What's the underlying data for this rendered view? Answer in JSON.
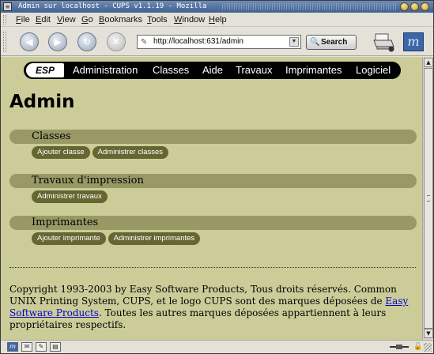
{
  "window": {
    "title": "Admin sur localhost - CUPS v1.1.19 - Mozilla",
    "system_menu_glyph": "≡"
  },
  "menubar": {
    "items": [
      {
        "mnemonic": "F",
        "rest": "ile"
      },
      {
        "mnemonic": "E",
        "rest": "dit"
      },
      {
        "mnemonic": "V",
        "rest": "iew"
      },
      {
        "mnemonic": "G",
        "rest": "o"
      },
      {
        "mnemonic": "B",
        "rest": "ookmarks"
      },
      {
        "mnemonic": "T",
        "rest": "ools"
      },
      {
        "mnemonic": "W",
        "rest": "indow"
      },
      {
        "mnemonic": "H",
        "rest": "elp"
      }
    ]
  },
  "toolbar": {
    "back_glyph": "◀",
    "forward_glyph": "▶",
    "reload_glyph": "↻",
    "stop_glyph": "✕",
    "url": "http://localhost:631/admin",
    "url_icon_glyph": "✎",
    "dropdown_glyph": "▼",
    "search_label": "Search",
    "search_icon_glyph": "🔍",
    "logo_glyph": "m"
  },
  "page": {
    "nav": {
      "brand": "ESP",
      "links": [
        "Administration",
        "Classes",
        "Aide",
        "Travaux",
        "Imprimantes",
        "Logiciel"
      ]
    },
    "heading": "Admin",
    "sections": [
      {
        "title": "Classes",
        "buttons": [
          "Ajouter classe",
          "Administrer classes"
        ]
      },
      {
        "title": "Travaux d'impression",
        "buttons": [
          "Administrer travaux"
        ]
      },
      {
        "title": "Imprimantes",
        "buttons": [
          "Ajouter imprimante",
          "Administrer imprimantes"
        ]
      }
    ],
    "footer": {
      "before_link": "Copyright 1993-2003 by Easy Software Products, Tous droits réservés. Common UNIX Printing System, CUPS, et le logo CUPS sont des marques déposées de ",
      "link_text": "Easy Software Products",
      "after_link": ". Toutes les autres marques déposées appartiennent à leurs propriétaires respectifs."
    }
  },
  "scrollbar": {
    "up_glyph": "▲",
    "down_glyph": "▼"
  },
  "statusbar": {
    "text": "",
    "icons": [
      {
        "name": "navigator-icon",
        "glyph": "m"
      },
      {
        "name": "mail-icon",
        "glyph": "✉"
      },
      {
        "name": "composer-icon",
        "glyph": "✎"
      },
      {
        "name": "address-book-icon",
        "glyph": "▤"
      }
    ],
    "lock_glyph": "🔓"
  },
  "colors": {
    "content_bg": "#cccc99",
    "section_bar": "#999966",
    "button_bg": "#666633",
    "nav_bg": "#000000",
    "link": "#0000cc"
  }
}
